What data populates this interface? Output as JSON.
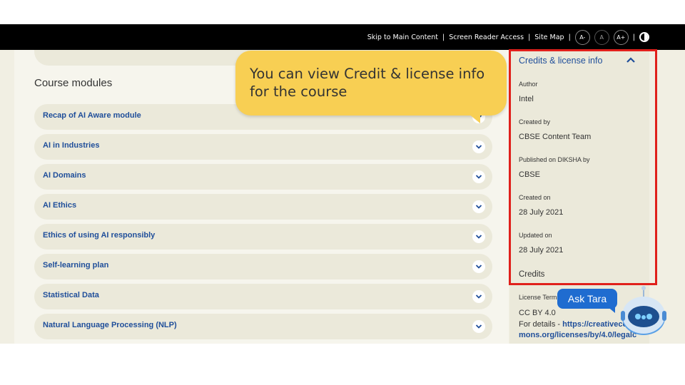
{
  "topbar": {
    "skip_link": "Skip to Main Content",
    "screen_reader": "Screen Reader Access",
    "site_map": "Site Map",
    "font_decrease": "A-",
    "font_normal": "A",
    "font_increase": "A+"
  },
  "main": {
    "section_title": "Course modules",
    "modules": [
      {
        "label": "Recap of AI Aware module"
      },
      {
        "label": "AI in Industries"
      },
      {
        "label": "AI Domains"
      },
      {
        "label": "AI Ethics"
      },
      {
        "label": "Ethics of using AI responsibly"
      },
      {
        "label": "Self-learning plan"
      },
      {
        "label": "Statistical Data"
      },
      {
        "label": "Natural Language Processing (NLP)"
      }
    ]
  },
  "sidebar": {
    "header": "Credits & license info",
    "author_label": "Author",
    "author_value": "Intel",
    "created_by_label": "Created by",
    "created_by_value": "CBSE Content Team",
    "published_label": "Published on DIKSHA by",
    "published_value": "CBSE",
    "created_on_label": "Created on",
    "created_on_value": "28 July 2021",
    "updated_on_label": "Updated on",
    "updated_on_value": "28 July 2021",
    "credits": "Credits",
    "license_label": "License Terms",
    "license_value": "CC BY 4.0",
    "details_prefix": "For details - ",
    "details_link": "https://creativecommons.org/licenses/by/4.0/legalc"
  },
  "tooltip": {
    "text": "You can view Credit & license info for the course"
  },
  "assistant": {
    "label": "Ask Tara"
  },
  "colors": {
    "accent_blue": "#1f4e9a",
    "tooltip_yellow": "#f8cf53",
    "highlight_red": "#e0201b",
    "page_bg": "#f1efe3"
  }
}
